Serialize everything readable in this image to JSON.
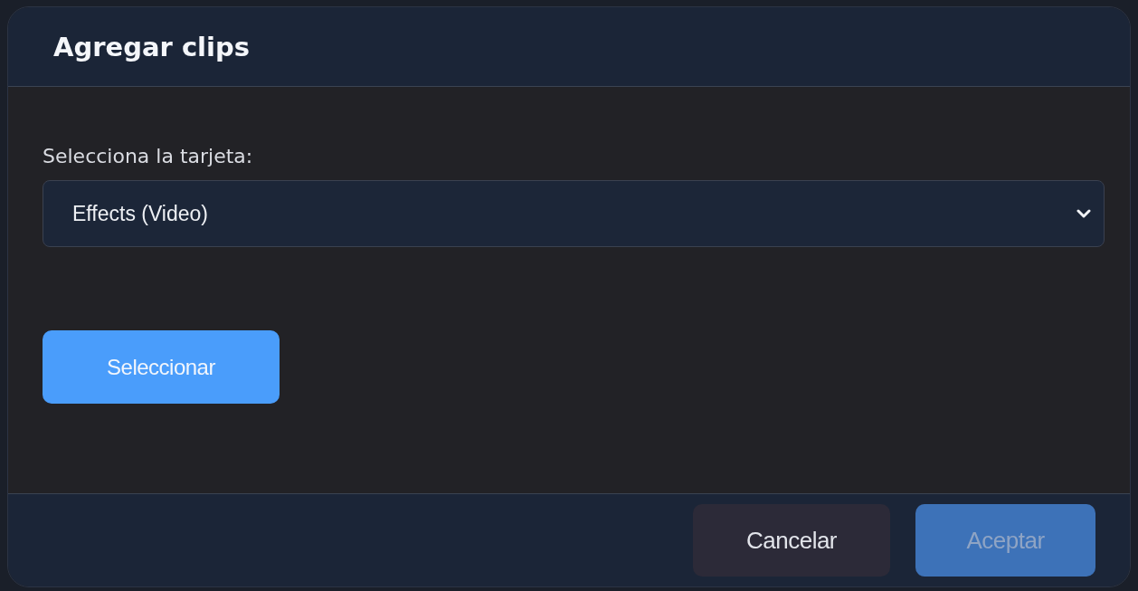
{
  "dialog": {
    "title": "Agregar clips"
  },
  "card_select": {
    "label": "Selecciona la tarjeta:",
    "value": "Effects (Video)"
  },
  "select_button": {
    "label": "Seleccionar"
  },
  "footer_buttons": [
    {
      "label": "Cancelar",
      "kind": "secondary",
      "disabled": false
    },
    {
      "label": "Aceptar",
      "kind": "primary",
      "disabled": true
    }
  ]
}
